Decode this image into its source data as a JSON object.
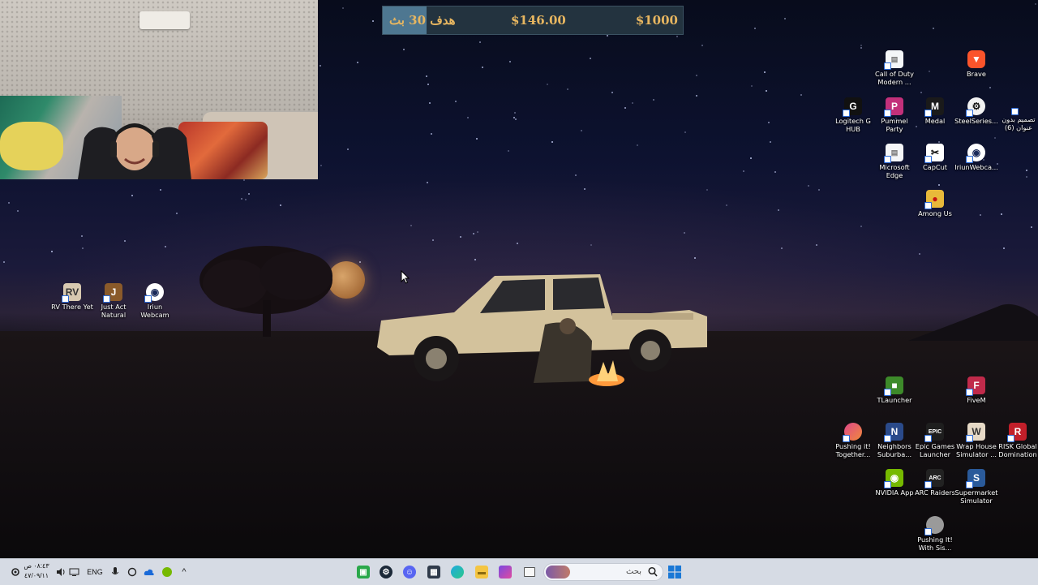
{
  "goal_bar": {
    "label": "هدف 30 بث",
    "current": "$146.00",
    "target": "$1000",
    "progress_fraction": 0.146,
    "colors": {
      "fill": "#4e7791",
      "track": "#23333f",
      "text": "#e7b660"
    }
  },
  "desktop_icons": [
    {
      "label": "Call of Duty Modern ...",
      "icon": "document-shortcut-icon"
    },
    {
      "label": "Brave",
      "icon": "brave-lion-icon"
    },
    {
      "label": "Logitech G HUB",
      "icon": "logitech-g-icon"
    },
    {
      "label": "Pummel Party",
      "icon": "pummel-party-icon"
    },
    {
      "label": "Medal",
      "icon": "medal-icon"
    },
    {
      "label": "SteelSeries...",
      "icon": "steelseries-icon"
    },
    {
      "label": "تصميم بدون عنوان (6)",
      "icon": "image-file-icon"
    },
    {
      "label": "Microsoft Edge",
      "icon": "document-shortcut-icon"
    },
    {
      "label": "CapCut",
      "icon": "capcut-icon"
    },
    {
      "label": "IriunWebca...",
      "icon": "iriun-webcam-icon"
    },
    {
      "label": "Among Us",
      "icon": "among-us-icon"
    },
    {
      "label": "RV There Yet",
      "icon": "rv-there-yet-icon"
    },
    {
      "label": "Just Act Natural",
      "icon": "just-act-natural-icon"
    },
    {
      "label": "Iriun Webcam",
      "icon": "iriun-webcam-icon"
    },
    {
      "label": "TLauncher",
      "icon": "tlauncher-icon"
    },
    {
      "label": "FiveM",
      "icon": "fivem-icon"
    },
    {
      "label": "Pushing it! Together...",
      "icon": "pushing-it-icon"
    },
    {
      "label": "Neighbors Suburba...",
      "icon": "neighbors-icon"
    },
    {
      "label": "Epic Games Launcher",
      "icon": "epic-games-icon"
    },
    {
      "label": "Wrap House Simulator ...",
      "icon": "wrap-house-icon"
    },
    {
      "label": "RISK Global Domination",
      "icon": "risk-icon"
    },
    {
      "label": "NVIDIA App",
      "icon": "nvidia-icon"
    },
    {
      "label": "ARC Raiders",
      "icon": "arc-raiders-icon"
    },
    {
      "label": "Supermarket Simulator",
      "icon": "supermarket-icon"
    },
    {
      "label": "Pushing It! With Sis...",
      "icon": "pushing-it-sis-icon"
    }
  ],
  "taskbar": {
    "search_placeholder": "بحث",
    "language": "ENG",
    "time": "٠٨:٤٣ ص",
    "date": "٤٧/٠٩/١١",
    "pinned_apps": [
      {
        "name": "terminal-app",
        "icon": "terminal-icon"
      },
      {
        "name": "steam-app",
        "icon": "steam-icon"
      },
      {
        "name": "discord-app",
        "icon": "discord-icon"
      },
      {
        "name": "store-app",
        "icon": "store-icon"
      },
      {
        "name": "edge-app",
        "icon": "edge-icon"
      },
      {
        "name": "file-explorer-app",
        "icon": "folder-icon"
      },
      {
        "name": "copilot-app",
        "icon": "copilot-icon"
      },
      {
        "name": "task-view",
        "icon": "task-view-icon"
      }
    ],
    "tray_icons": [
      "settings-icon",
      "volume-icon",
      "network-icon",
      "microphone-icon",
      "sync-icon",
      "cloud-icon",
      "nvidia-tray-icon",
      "chevron-up-icon"
    ]
  }
}
